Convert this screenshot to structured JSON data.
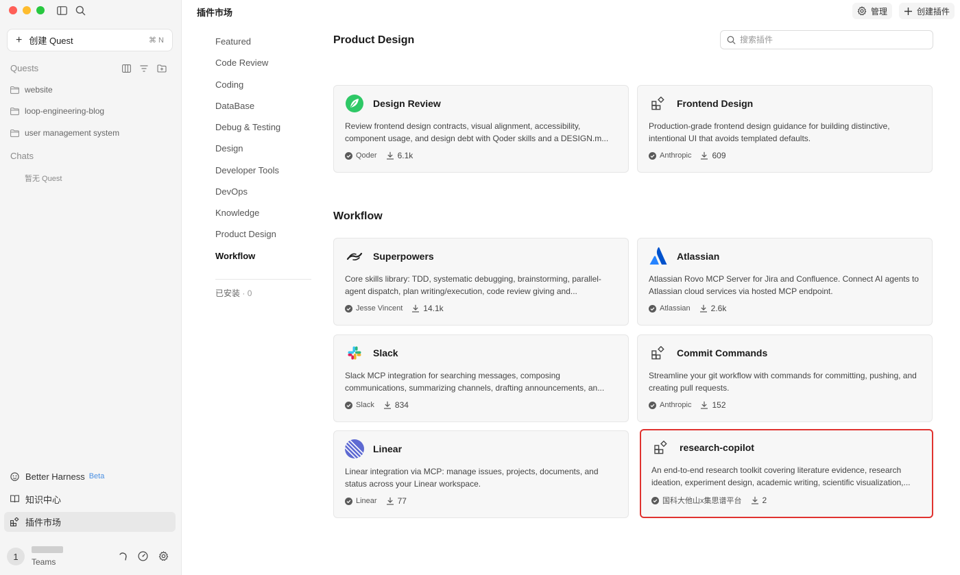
{
  "sidebar": {
    "new_quest_label": "创建 Quest",
    "new_quest_shortcut": "⌘ N",
    "quests_heading": "Quests",
    "quests": [
      "website",
      "loop-engineering-blog",
      "user management system"
    ],
    "chats_heading": "Chats",
    "chats_empty": "暂无 Quest",
    "bottom": {
      "better_harness": "Better Harness",
      "beta": "Beta",
      "knowledge_center": "知识中心",
      "plugin_market": "插件市场"
    },
    "user": {
      "avatar_initial": "1",
      "team": "Teams"
    }
  },
  "header": {
    "title": "插件市场",
    "manage_label": "管理",
    "create_plugin_label": "创建插件"
  },
  "categories": {
    "items": [
      "Featured",
      "Code Review",
      "Coding",
      "DataBase",
      "Debug & Testing",
      "Design",
      "Developer Tools",
      "DevOps",
      "Knowledge",
      "Product Design",
      "Workflow"
    ],
    "active": "Workflow",
    "installed_label": "已安装",
    "installed_sep": "·",
    "installed_count": "0"
  },
  "search": {
    "placeholder": "搜索插件"
  },
  "sections": [
    {
      "title": "Product Design",
      "cards": [
        {
          "title": "Design Review",
          "desc": "Review frontend design contracts, visual alignment, accessibility, component usage, and design debt with Qoder skills and a DESIGN.m...",
          "author": "Qoder",
          "downloads": "6.1k",
          "icon": "qoder-leaf-icon"
        },
        {
          "title": "Frontend Design",
          "desc": "Production-grade frontend design guidance for building distinctive, intentional UI that avoids templated defaults.",
          "author": "Anthropic",
          "downloads": "609",
          "icon": "plugin-grid-icon"
        }
      ]
    },
    {
      "title": "Workflow",
      "cards": [
        {
          "title": "Superpowers",
          "desc": "Core skills library: TDD, systematic debugging, brainstorming, parallel-agent dispatch, plan writing/execution, code review giving and...",
          "author": "Jesse Vincent",
          "downloads": "14.1k",
          "icon": "superpowers-icon"
        },
        {
          "title": "Atlassian",
          "desc": "Atlassian Rovo MCP Server for Jira and Confluence. Connect AI agents to Atlassian cloud services via hosted MCP endpoint.",
          "author": "Atlassian",
          "downloads": "2.6k",
          "icon": "atlassian-icon"
        },
        {
          "title": "Slack",
          "desc": "Slack MCP integration for searching messages, composing communications, summarizing channels, drafting announcements, an...",
          "author": "Slack",
          "downloads": "834",
          "icon": "slack-icon"
        },
        {
          "title": "Commit Commands",
          "desc": "Streamline your git workflow with commands for committing, pushing, and creating pull requests.",
          "author": "Anthropic",
          "downloads": "152",
          "icon": "plugin-grid-icon"
        },
        {
          "title": "Linear",
          "desc": "Linear integration via MCP: manage issues, projects, documents, and status across your Linear workspace.",
          "author": "Linear",
          "downloads": "77",
          "icon": "linear-icon"
        },
        {
          "title": "research-copilot",
          "desc": "An end-to-end research toolkit covering literature evidence, research ideation, experiment design, academic writing, scientific visualization,...",
          "author": "国科大他山x集思谱平台",
          "downloads": "2",
          "icon": "plugin-grid-icon",
          "highlighted": true
        }
      ]
    }
  ],
  "colors": {
    "highlight_border": "#e0322f",
    "beta": "#4a90e2",
    "card_bg": "#f7f7f7"
  }
}
